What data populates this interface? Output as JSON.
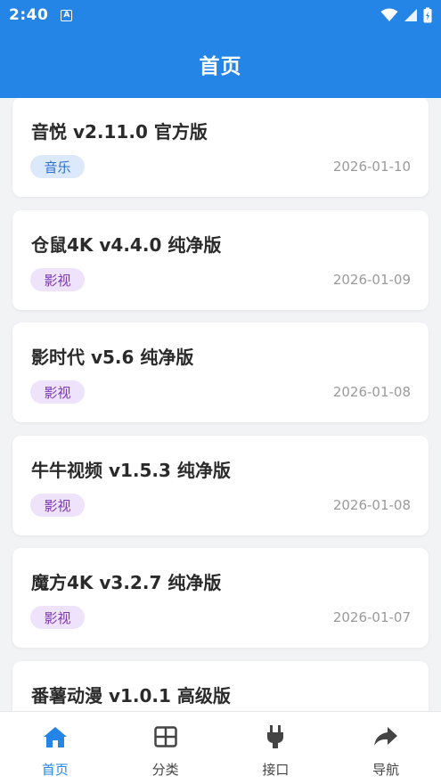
{
  "status_bar": {
    "time": "2:40",
    "app_icon_letter": "A"
  },
  "app_bar": {
    "title": "首页"
  },
  "items": [
    {
      "title": "音悦 v2.11.0 官方版",
      "tag": "音乐",
      "date": "2026-01-10"
    },
    {
      "title": "仓鼠4K v4.4.0 纯净版",
      "tag": "影视",
      "date": "2026-01-09"
    },
    {
      "title": "影时代 v5.6 纯净版",
      "tag": "影视",
      "date": "2026-01-08"
    },
    {
      "title": "牛牛视频 v1.5.3 纯净版",
      "tag": "影视",
      "date": "2026-01-08"
    },
    {
      "title": "魔方4K v3.2.7 纯净版",
      "tag": "影视",
      "date": "2026-01-07"
    },
    {
      "title": "番薯动漫 v1.0.1 高级版",
      "tag": "",
      "date": ""
    }
  ],
  "bottom_nav": [
    {
      "label": "首页",
      "icon": "home-icon",
      "active": true
    },
    {
      "label": "分类",
      "icon": "grid-icon",
      "active": false
    },
    {
      "label": "接口",
      "icon": "plug-icon",
      "active": false
    },
    {
      "label": "导航",
      "icon": "share-arrow-icon",
      "active": false
    }
  ],
  "colors": {
    "primary": "#2485e6",
    "music_tag_bg": "#dce9fb",
    "video_tag_bg": "#efe2fb"
  }
}
